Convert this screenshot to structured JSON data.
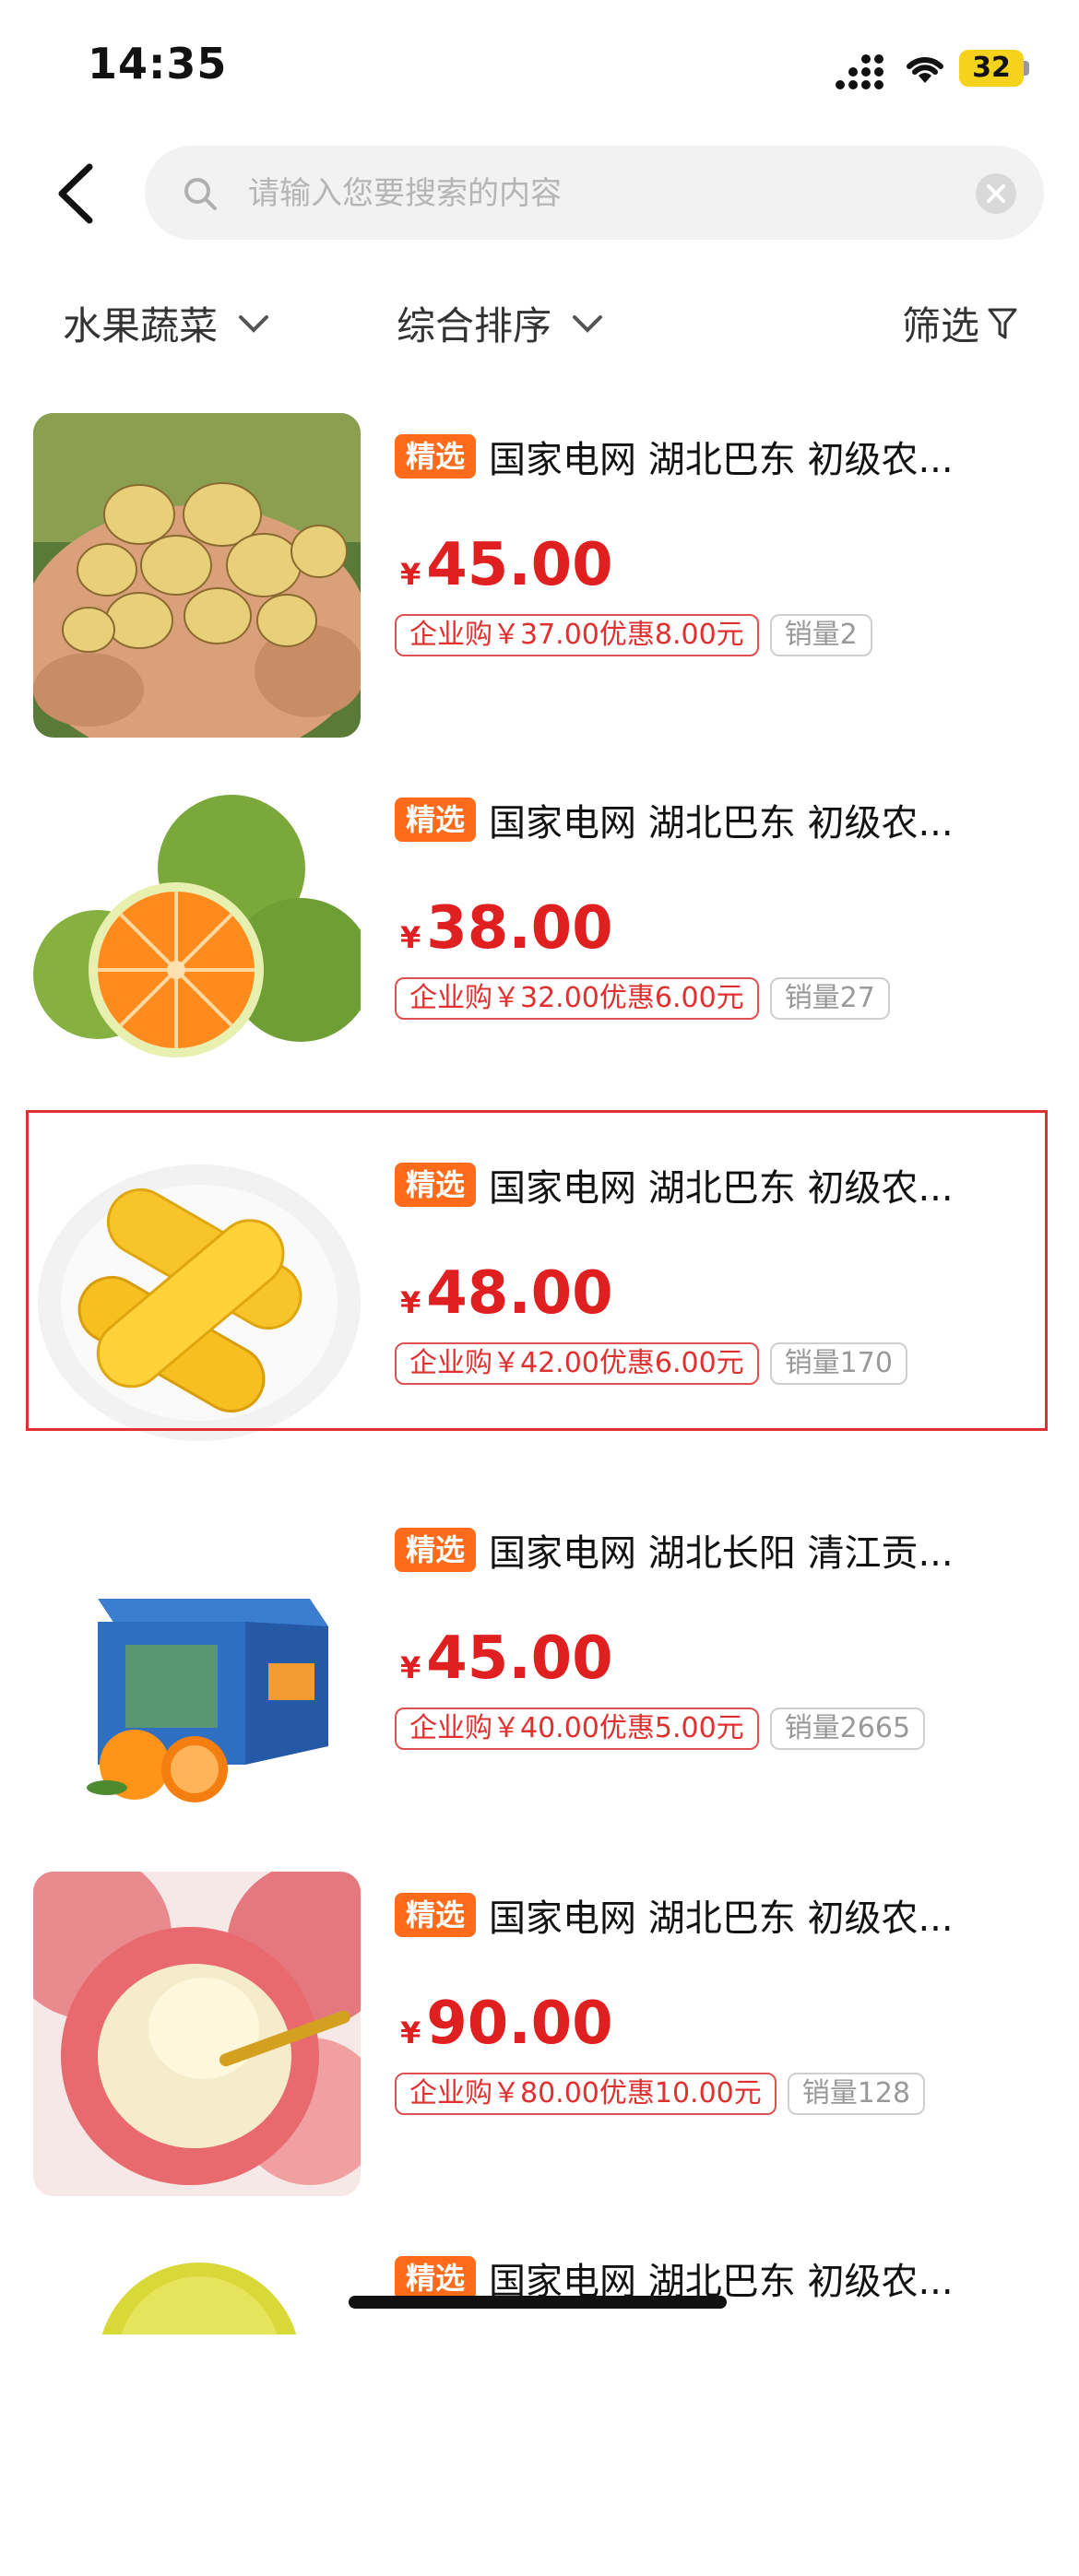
{
  "status_bar": {
    "time": "14:35",
    "battery": "32"
  },
  "search": {
    "placeholder": "请输入您要搜索的内容",
    "value": ""
  },
  "filters": {
    "category": "水果蔬菜",
    "sort": "综合排序",
    "filter": "筛选"
  },
  "products": [
    {
      "tag": "精选",
      "title": "国家电网 湖北巴东 初级农...",
      "currency": "¥",
      "price": "45.00",
      "enterprise": "企业购￥37.00优惠8.00元",
      "sales": "销量2",
      "image": "potatoes"
    },
    {
      "tag": "精选",
      "title": "国家电网 湖北巴东 初级农...",
      "currency": "¥",
      "price": "38.00",
      "enterprise": "企业购￥32.00优惠6.00元",
      "sales": "销量27",
      "image": "green-oranges"
    },
    {
      "tag": "精选",
      "title": "国家电网 湖北巴东 初级农...",
      "currency": "¥",
      "price": "48.00",
      "enterprise": "企业购￥42.00优惠6.00元",
      "sales": "销量170",
      "image": "corn"
    },
    {
      "tag": "精选",
      "title": "国家电网 湖北长阳 清江贡...",
      "currency": "¥",
      "price": "45.00",
      "enterprise": "企业购￥40.00优惠5.00元",
      "sales": "销量2665",
      "image": "orange-gift-box"
    },
    {
      "tag": "精选",
      "title": "国家电网 湖北巴东 初级农...",
      "currency": "¥",
      "price": "90.00",
      "enterprise": "企业购￥80.00优惠10.00元",
      "sales": "销量128",
      "image": "apples"
    },
    {
      "tag": "精选",
      "title": "国家电网 湖北巴东 初级农...",
      "image": "pomelo"
    }
  ],
  "colors": {
    "price": "#e02020",
    "tag": "#ff6a1b",
    "highlight_border": "#e03030"
  }
}
